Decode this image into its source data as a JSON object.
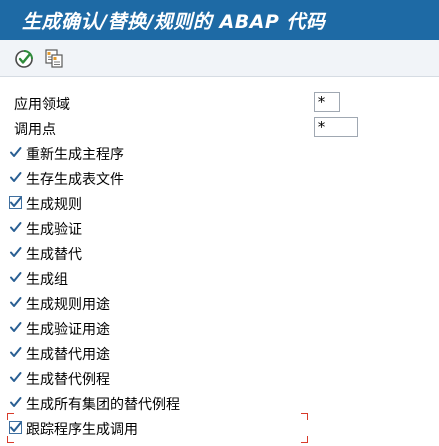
{
  "window": {
    "title": "生成确认/替换/规则的 ABAP 代码"
  },
  "toolbar": {
    "buttons": [
      {
        "icon": "execute-icon"
      },
      {
        "icon": "variant-icon"
      }
    ]
  },
  "fields": [
    {
      "label": "应用领域",
      "value": "*"
    },
    {
      "label": "调用点",
      "value": "*"
    }
  ],
  "checkboxes": [
    {
      "label": "重新生成主程序",
      "checked": true
    },
    {
      "label": "生存生成表文件",
      "checked": true
    },
    {
      "label": "生成规则",
      "checked": true
    },
    {
      "label": "生成验证",
      "checked": true
    },
    {
      "label": "生成替代",
      "checked": true
    },
    {
      "label": "生成组",
      "checked": true
    },
    {
      "label": "生成规则用途",
      "checked": true
    },
    {
      "label": "生成验证用途",
      "checked": true
    },
    {
      "label": "生成替代用途",
      "checked": true
    },
    {
      "label": "生成替代例程",
      "checked": true
    },
    {
      "label": "生成所有集团的替代例程",
      "checked": true
    },
    {
      "label": "跟踪程序生成调用",
      "checked": true
    }
  ],
  "colors": {
    "title_bar": "#1e6aa5",
    "check_mark": "#2a5f93",
    "focus_outline": "#d83a2a"
  }
}
